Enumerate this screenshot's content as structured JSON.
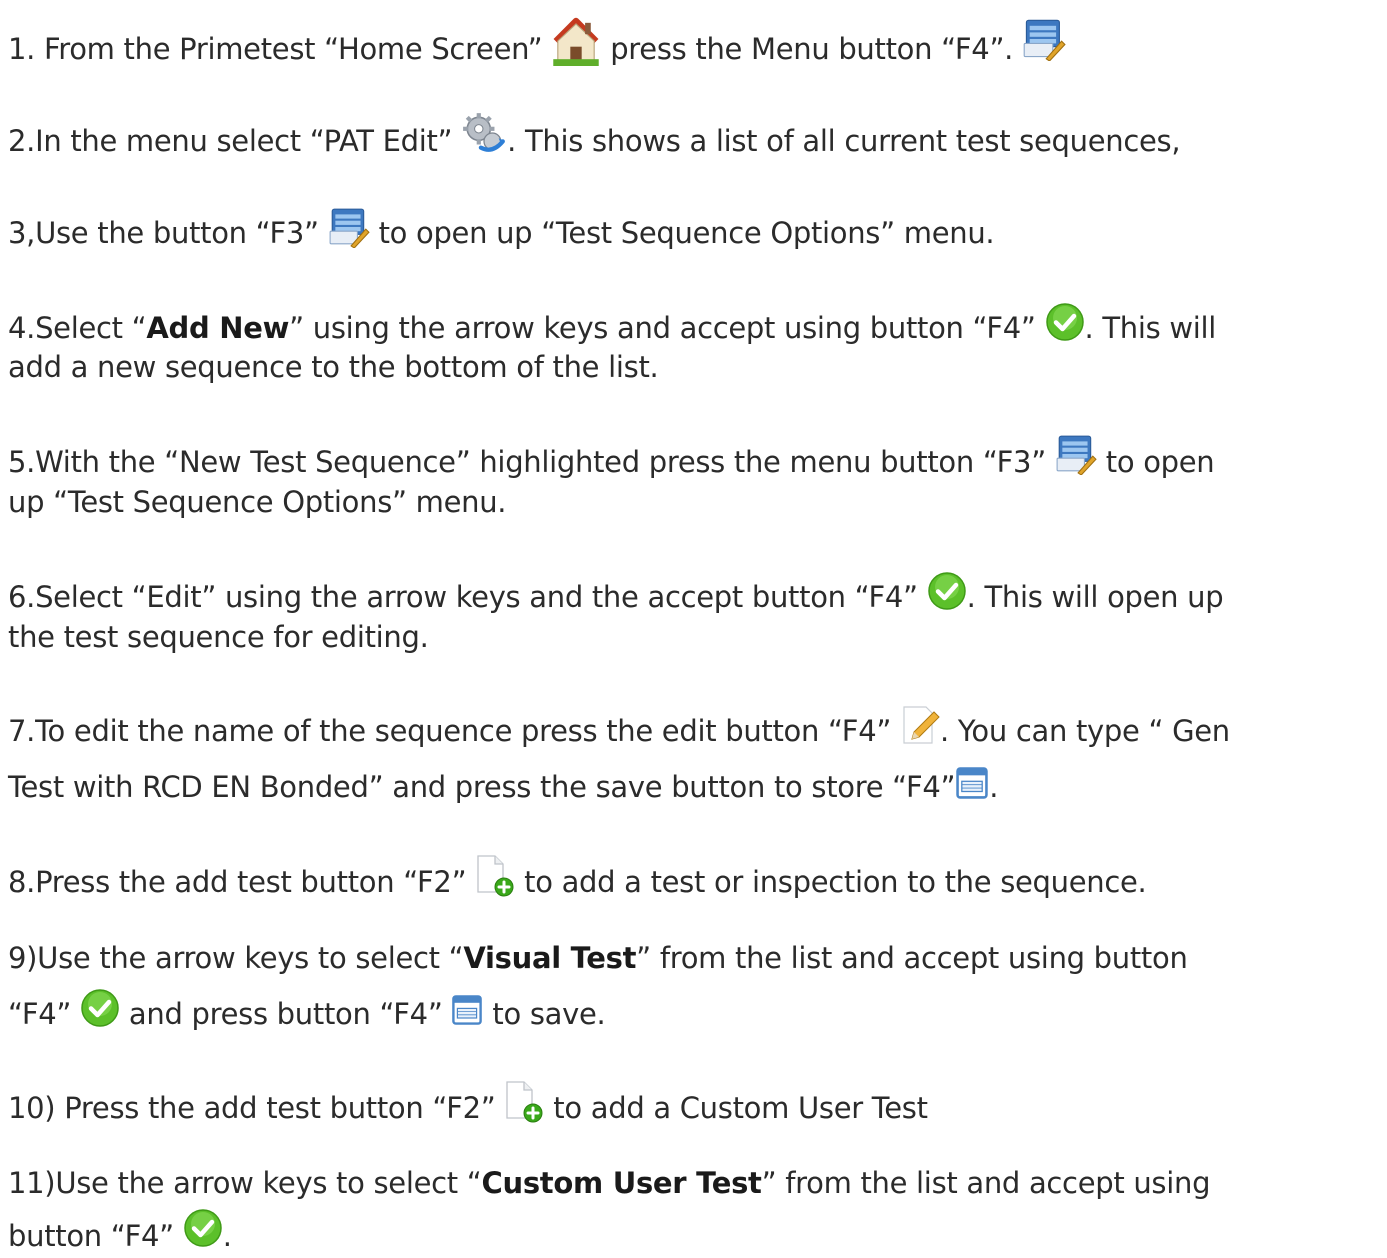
{
  "steps": {
    "s1": {
      "a": "1. From the  Primetest “Home Screen” ",
      "b": " press the Menu button “F4”. "
    },
    "s2": {
      "a": "2.In the menu select “PAT Edit” ",
      "b": ". This shows a list of all current test sequences,"
    },
    "s3": {
      "a": "3,Use the button “F3” ",
      "b": " to open up “Test Sequence Options” menu."
    },
    "s4": {
      "a": "4.Select “",
      "bold": "Add New",
      "b": "” using the arrow keys and accept using button “F4” ",
      "c": ". This will",
      "d": "add a new sequence to the bottom of the list."
    },
    "s5": {
      "a": "5.With the “New Test Sequence” highlighted press the menu button “F3” ",
      "b": " to open",
      "c": "up “Test Sequence Options” menu."
    },
    "s6": {
      "a": "6.Select “Edit” using the arrow keys and the accept button “F4” ",
      "b": ". This will open up",
      "c": "the test sequence for editing."
    },
    "s7": {
      "a": "7.To edit the name of the sequence press the edit button “F4” ",
      "b": ". You can type “ Gen",
      "c": "Test with RCD  EN Bonded”  and press the save button to store “F4”",
      "d": "."
    },
    "s8": {
      "a": "8.Press the add test button “F2” ",
      "b": " to add a test or inspection to the sequence."
    },
    "s9": {
      "a": "9)Use the arrow keys to select   “",
      "bold": "Visual Test",
      "b": "”  from the list and accept using button",
      "c": "“F4” ",
      "d": " and press button “F4” ",
      "e": "  to save."
    },
    "s10": {
      "a": "10) Press the add test button “F2” ",
      "b": " to add a Custom  User Test"
    },
    "s11": {
      "a": "11)Use the arrow keys to select   “",
      "bold": "Custom User Test",
      "b": "”  from the list and accept using",
      "c": "button “F4” ",
      "d": "."
    }
  },
  "icons": {
    "home": "home-icon",
    "menu": "menu-icon",
    "gears": "gears-icon",
    "accept": "checkmark-icon",
    "edit": "pencil-icon",
    "save": "save-icon",
    "add_test": "add-document-icon"
  },
  "colors": {
    "text": "#2b2b2b",
    "accept_green": "#5cc02a",
    "save_blue": "#4a86c8",
    "menu_blue": "#3d78c0"
  }
}
